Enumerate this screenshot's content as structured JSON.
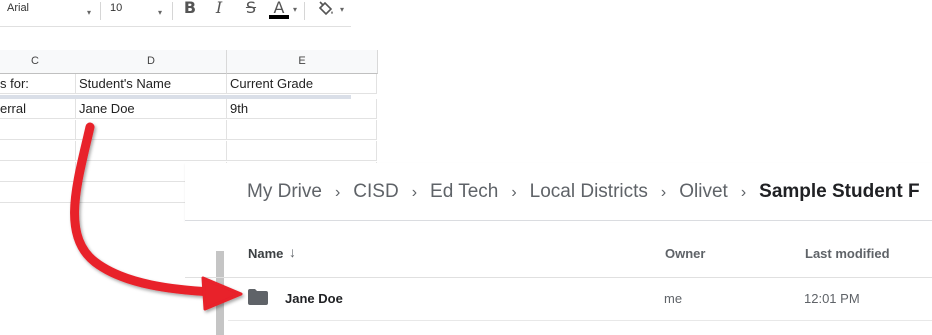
{
  "spreadsheet": {
    "toolbar": {
      "font": "Arial",
      "font_size": "10",
      "bold": "B",
      "italic": "I",
      "strike": "S",
      "text_color": "A",
      "text_color_bar": "#000000",
      "dropdown_caret": "▾"
    },
    "columns": [
      "C",
      "D",
      "E"
    ],
    "rows": [
      [
        "s for:",
        "Student's Name",
        "Current Grade"
      ],
      [
        "erral",
        "Jane Doe",
        "9th"
      ],
      [
        "",
        "",
        ""
      ],
      [
        "",
        "",
        ""
      ],
      [
        "",
        "",
        ""
      ],
      [
        "",
        "",
        ""
      ]
    ]
  },
  "drive": {
    "breadcrumb": [
      "My Drive",
      "CISD",
      "Ed Tech",
      "Local Districts",
      "Olivet",
      "Sample Student F"
    ],
    "breadcrumb_separator": "›",
    "headers": {
      "name": "Name",
      "sort_arrow": "↓",
      "owner": "Owner",
      "modified": "Last modified"
    },
    "rows": [
      {
        "icon": "folder-icon",
        "name": "Jane Doe",
        "owner": "me",
        "modified": "12:01 PM"
      }
    ]
  },
  "colors": {
    "arrow": "#e8202a",
    "folder": "#5f6368"
  }
}
